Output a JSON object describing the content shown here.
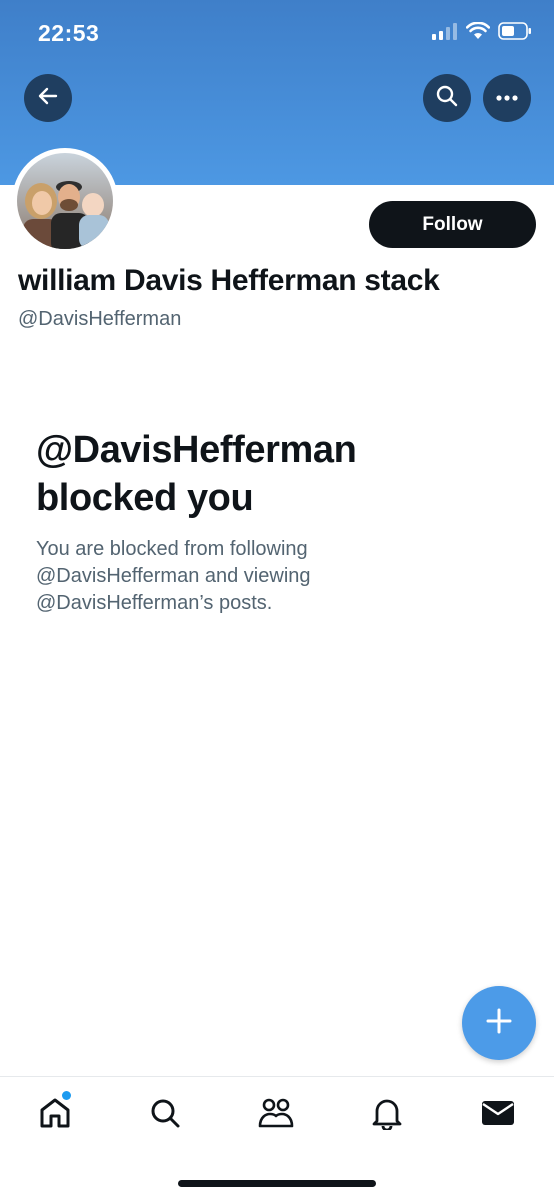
{
  "status_bar": {
    "time": "22:53",
    "icons": [
      "cellular-signal-icon",
      "wifi-icon",
      "battery-icon"
    ]
  },
  "header": {
    "back_icon": "arrow-left-icon",
    "search_icon": "search-icon",
    "more_icon": "more-horizontal-icon",
    "banner_color": "#4a90dc"
  },
  "profile": {
    "display_name": "william Davis Hefferman stack",
    "handle": "@DavisHefferman",
    "follow_label": "Follow"
  },
  "blocked": {
    "title_line1": "@DavisHefferman",
    "title_line2": "blocked you",
    "desc_line1": "You are blocked from following",
    "desc_line2": "@DavisHefferman and viewing",
    "desc_line3": "@DavisHefferman’s posts."
  },
  "fab": {
    "icon": "plus-icon",
    "color": "#4c9be8"
  },
  "tab_bar": {
    "items": [
      {
        "name": "home",
        "icon": "home-icon",
        "has_unread": true
      },
      {
        "name": "search",
        "icon": "search-icon"
      },
      {
        "name": "communities",
        "icon": "communities-icon"
      },
      {
        "name": "notifications",
        "icon": "bell-icon"
      },
      {
        "name": "messages",
        "icon": "envelope-icon"
      }
    ]
  }
}
